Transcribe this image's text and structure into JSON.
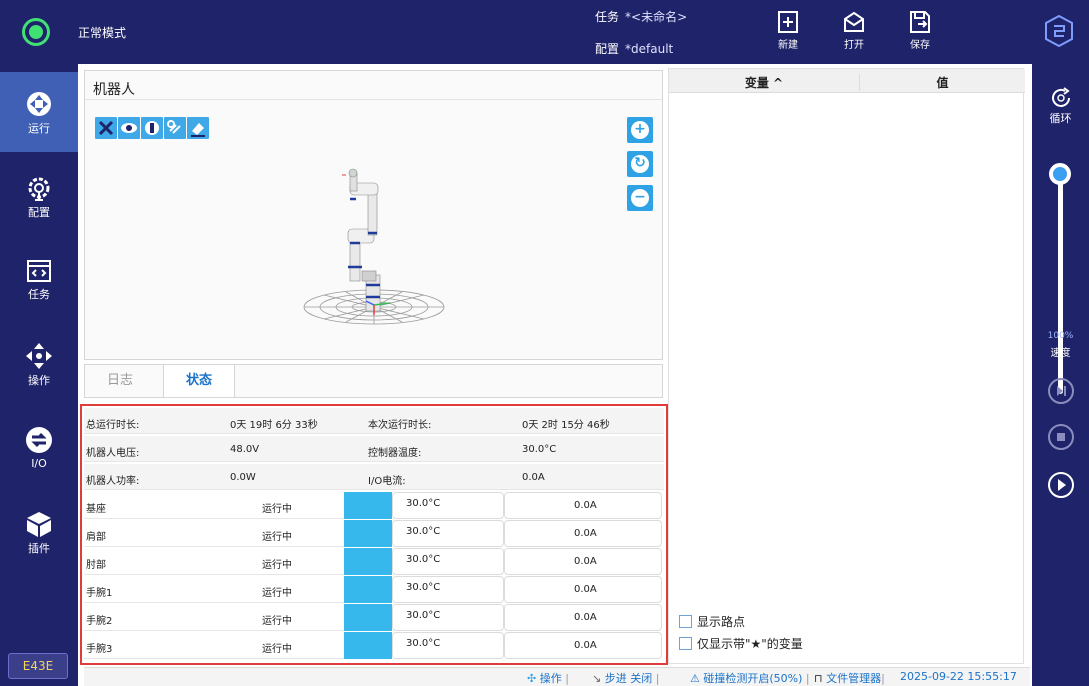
{
  "topbar": {
    "mode": "正常模式",
    "task_label": "任务",
    "task_value": "*<未命名>",
    "config_label": "配置",
    "config_value": "*default",
    "buttons": {
      "new": "新建",
      "open": "打开",
      "save": "保存"
    }
  },
  "leftnav": {
    "items": [
      {
        "label": "运行",
        "icon": "run-icon"
      },
      {
        "label": "配置",
        "icon": "config-gear-icon"
      },
      {
        "label": "任务",
        "icon": "code-window-icon"
      },
      {
        "label": "操作",
        "icon": "move-arrows-icon"
      },
      {
        "label": "I/O",
        "icon": "io-arrows-icon"
      },
      {
        "label": "插件",
        "icon": "cube-icon"
      }
    ],
    "error_code": "E43E"
  },
  "rightbar": {
    "loop_label": "循环",
    "speed_value": "100%",
    "speed_label": "速度",
    "speed_level": 1.0
  },
  "robot_panel": {
    "title": "机器人"
  },
  "tabs": {
    "log": "日志",
    "status": "状态"
  },
  "status": {
    "summary": [
      {
        "l1": "总运行时长:",
        "v1": "0天 19时 6分 33秒",
        "l2": "本次运行时长:",
        "v2": "0天 2时 15分 46秒"
      },
      {
        "l1": "机器人电压:",
        "v1": "48.0V",
        "l2": "控制器温度:",
        "v2": "30.0°C"
      },
      {
        "l1": "机器人功率:",
        "v1": "0.0W",
        "l2": "I/O电流:",
        "v2": "0.0A"
      }
    ],
    "joints": [
      {
        "name": "基座",
        "state": "运行中",
        "temp": "30.0°C",
        "current": "0.0A"
      },
      {
        "name": "肩部",
        "state": "运行中",
        "temp": "30.0°C",
        "current": "0.0A"
      },
      {
        "name": "肘部",
        "state": "运行中",
        "temp": "30.0°C",
        "current": "0.0A"
      },
      {
        "name": "手腕1",
        "state": "运行中",
        "temp": "30.0°C",
        "current": "0.0A"
      },
      {
        "name": "手腕2",
        "state": "运行中",
        "temp": "30.0°C",
        "current": "0.0A"
      },
      {
        "name": "手腕3",
        "state": "运行中",
        "temp": "30.0°C",
        "current": "0.0A"
      }
    ]
  },
  "variables": {
    "col_var": "变量 ^",
    "col_val": "值",
    "show_waypoints": "显示路点",
    "only_starred": "仅显示带\"★\"的变量"
  },
  "statusbar": {
    "operate": "操作",
    "step": "步进 关闭",
    "collision": "碰撞检测开启(50%)",
    "file_manager": "文件管理器",
    "datetime": "2025-09-22 15:55:17"
  },
  "colors": {
    "nav_bg": "#1f2369",
    "active": "#3f60b4",
    "accent": "#2fa2e6",
    "alert_border": "#e03c3c",
    "mode_green": "#41e072"
  }
}
